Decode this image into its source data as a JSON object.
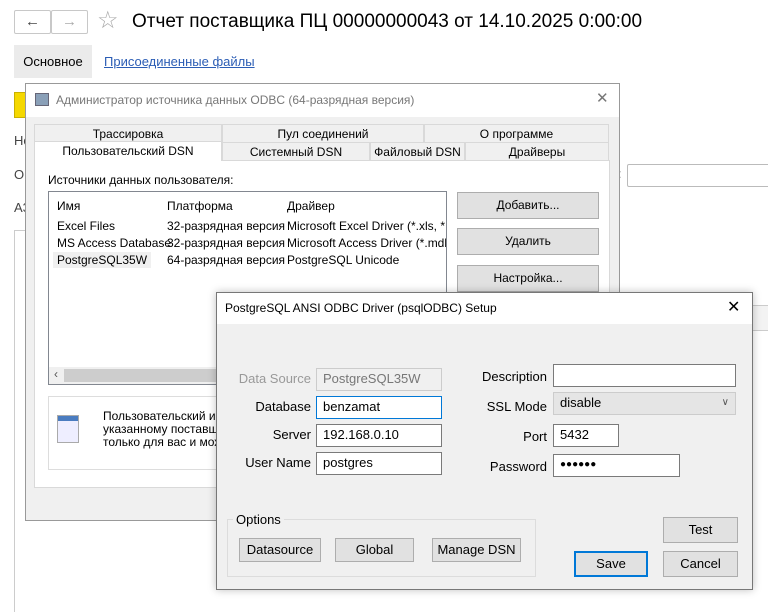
{
  "main_window": {
    "title": "Отчет поставщика ПЦ 00000000043 от 14.10.2025 0:00:00",
    "back_icon": "←",
    "forward_icon": "→",
    "star_icon": "☆",
    "tabs": [
      {
        "label": "Основное"
      },
      {
        "label": "Присоединенные файлы"
      }
    ],
    "partial_labels": [
      "Но",
      "О",
      "А3"
    ],
    "colon": ":"
  },
  "odbc_admin": {
    "title": "Администратор источника данных ODBC (64-разрядная версия)",
    "close_icon": "✕",
    "tabs_row1": [
      "Трассировка",
      "Пул соединений",
      "О программе"
    ],
    "tabs_row2": [
      "Пользовательский DSN",
      "Системный DSN",
      "Файловый DSN",
      "Драйверы"
    ],
    "list_label": "Источники данных пользователя:",
    "columns": [
      "Имя",
      "Платформа",
      "Драйвер"
    ],
    "rows": [
      [
        "Excel Files",
        "32-разрядная версия",
        "Microsoft Excel Driver (*.xls, *.xlsx"
      ],
      [
        "MS Access Database",
        "32-разрядная версия",
        "Microsoft Access Driver (*.mdb, *."
      ],
      [
        "PostgreSQL35W",
        "64-разрядная версия",
        "PostgreSQL Unicode"
      ]
    ],
    "buttons": {
      "add": "Добавить...",
      "remove": "Удалить",
      "configure": "Настройка..."
    },
    "info_lines": [
      "Пользовательский ист",
      "указанному поставщи",
      "только для вас и може"
    ]
  },
  "pg_setup": {
    "title": "PostgreSQL ANSI ODBC Driver (psqlODBC) Setup",
    "close_icon": "✕",
    "data_source": {
      "label": "Data Source",
      "value": "PostgreSQL35W"
    },
    "database": {
      "label": "Database",
      "value": "benzamat"
    },
    "server": {
      "label": "Server",
      "value": "192.168.0.10"
    },
    "user_name": {
      "label": "User Name",
      "value": "postgres"
    },
    "description": {
      "label": "Description",
      "value": ""
    },
    "ssl_mode": {
      "label": "SSL Mode",
      "value": "disable"
    },
    "port": {
      "label": "Port",
      "value": "5432"
    },
    "password": {
      "label": "Password",
      "value": "●●●●●●"
    },
    "options": {
      "label": "Options",
      "datasource": "Datasource",
      "global": "Global",
      "manage_dsn": "Manage DSN"
    },
    "test": "Test",
    "save": "Save",
    "cancel": "Cancel"
  }
}
